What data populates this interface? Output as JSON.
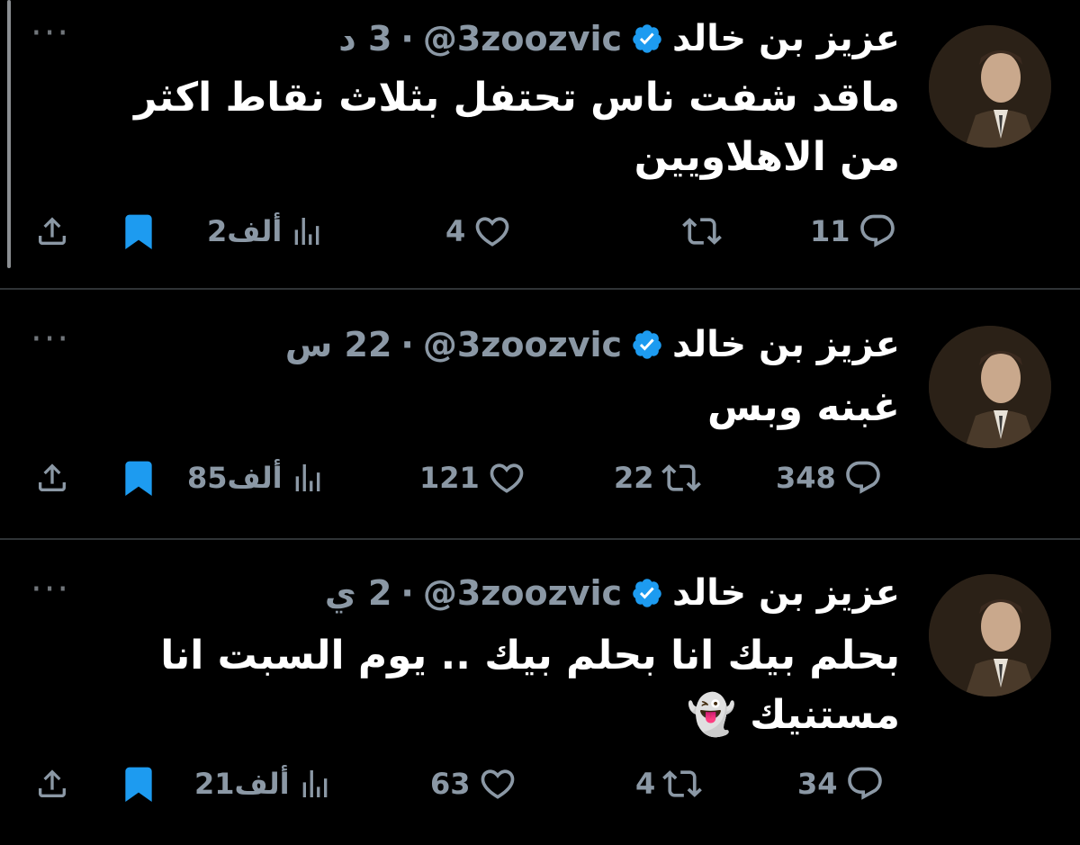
{
  "tweets": [
    {
      "name": "عزيز بن خالد",
      "handle": "@3zoozvic",
      "dot": "·",
      "time": "3 د",
      "text": "ماقد شفت ناس تحتفل بثلاث نقاط اكثر من الاهلاويين",
      "replies": "11",
      "retweets": "",
      "likes": "4",
      "views": "2ألف"
    },
    {
      "name": "عزيز بن خالد",
      "handle": "@3zoozvic",
      "dot": "·",
      "time": "22 س",
      "text": "غبنه وبس",
      "replies": "348",
      "retweets": "22",
      "likes": "121",
      "views": "85ألف"
    },
    {
      "name": "عزيز بن خالد",
      "handle": "@3zoozvic",
      "dot": "·",
      "time": "2 ي",
      "text": "بحلم بيك انا بحلم بيك .. يوم السبت انا مستنيك 👻",
      "replies": "34",
      "retweets": "4",
      "likes": "63",
      "views": "21ألف"
    }
  ],
  "colors": {
    "background": "#000000",
    "text": "#ffffff",
    "muted": "#8b98a5",
    "verified": "#1d9bf0",
    "bookmark": "#1d9bf0",
    "divider": "#2f3336"
  },
  "icons": {
    "more": "more-icon",
    "verified": "verified-badge-icon",
    "reply": "reply-icon",
    "retweet": "retweet-icon",
    "like": "heart-icon",
    "views": "views-icon",
    "bookmark": "bookmark-icon",
    "share": "share-icon"
  },
  "more_label": "···"
}
